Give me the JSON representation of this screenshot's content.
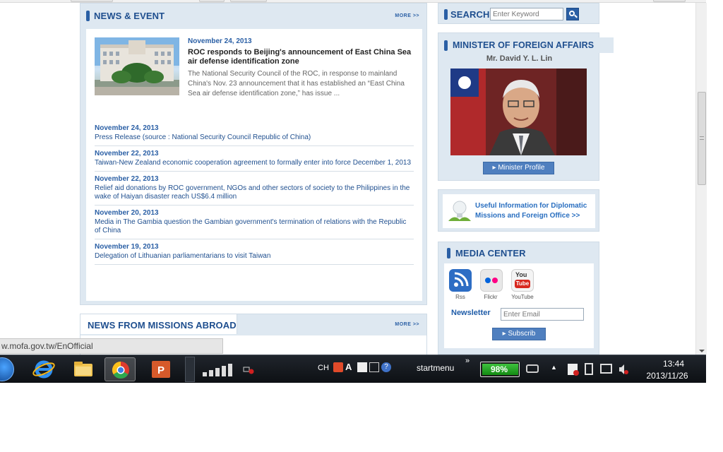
{
  "status_bar": {
    "url": "w.mofa.gov.tw/EnOfficial"
  },
  "news_event": {
    "title": "NEWS & EVENT",
    "more": "MORE >>",
    "feature": {
      "date": "November 24, 2013",
      "title": "ROC responds to Beijing's announcement of East China Sea air defense identification zone",
      "summary": "The National Security Council of the ROC, in response to mainland China's Nov. 23 announcement that it has established an “East China Sea air defense identification zone,” has issue ..."
    },
    "items": [
      {
        "date": "November 24, 2013",
        "title": "Press Release (source : National Security Council Republic of China)"
      },
      {
        "date": "November 22, 2013",
        "title": "Taiwan-New Zealand economic cooperation agreement to formally enter into force December 1, 2013"
      },
      {
        "date": "November 22, 2013",
        "title": "Relief aid donations by ROC government, NGOs and other sectors of society to the Philippines in the wake of Haiyan disaster reach US$6.4 million"
      },
      {
        "date": "November 20, 2013",
        "title": "Media in The Gambia question the Gambian government's termination of relations with the Republic of China"
      },
      {
        "date": "November 19, 2013",
        "title": "Delegation of Lithuanian parliamentarians to visit Taiwan"
      }
    ]
  },
  "missions": {
    "title": "NEWS FROM MISSIONS ABROAD",
    "more": "MORE >>"
  },
  "search": {
    "title": "SEARCH",
    "placeholder": "Enter Keyword"
  },
  "minister": {
    "title": "MINISTER OF FOREIGN AFFAIRS",
    "name": "Mr. David Y. L. Lin",
    "button": "Minister Profile"
  },
  "useful": {
    "line1": "Useful Information for Diplomatic",
    "line2": "Missions and Foreign Office  >>"
  },
  "media": {
    "title": "MEDIA CENTER",
    "rss": "Rss",
    "flickr": "Flickr",
    "youtube": "YouTube",
    "youtube_logo_top": "You",
    "youtube_logo_bottom": "Tube",
    "newsletter": "Newsletter",
    "email_placeholder": "Enter Email",
    "subscribe": "Subscrib"
  },
  "taskbar": {
    "lang": "CH",
    "startmenu": "startmenu",
    "battery": "98%",
    "battery_level": 0.98,
    "time": "13:44",
    "date": "2013/11/26"
  },
  "colors": {
    "accent": "#2a5fa5",
    "panel": "#dee8f1",
    "taskbar": "#14181d"
  }
}
